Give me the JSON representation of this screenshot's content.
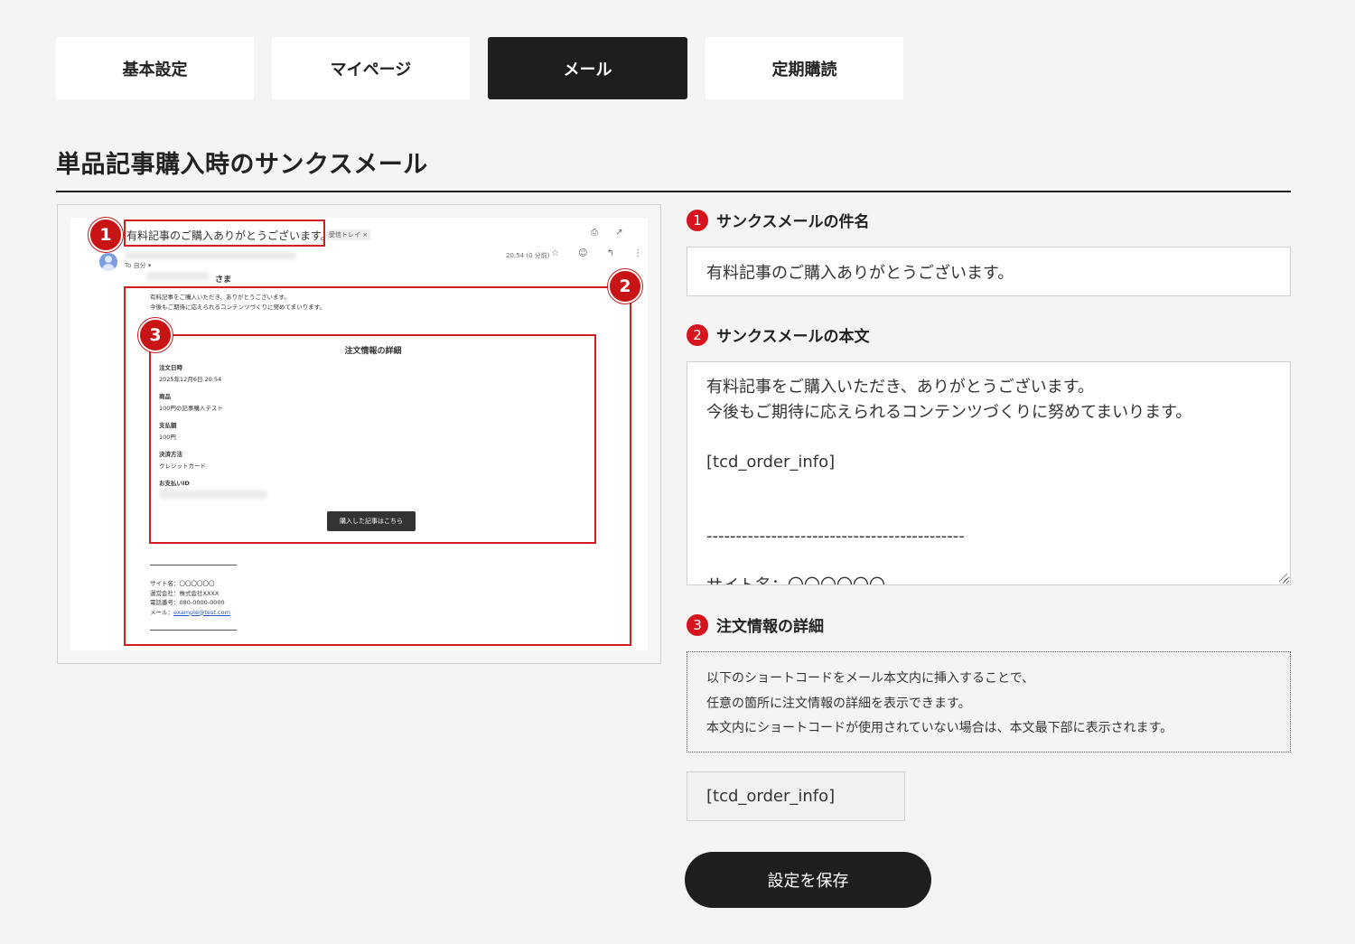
{
  "tabs": [
    {
      "label": "基本設定"
    },
    {
      "label": "マイページ"
    },
    {
      "label": "メール",
      "active": true
    },
    {
      "label": "定期購読"
    }
  ],
  "page_title": "単品記事購入時のサンクスメール",
  "preview": {
    "subject": "有料記事のご購入ありがとうございます。",
    "inbox_tag": "受信トレイ ×",
    "to_line": "To 自分 ▾",
    "time": "20:54 (0 分前)",
    "top_icons": "⎙ ↗",
    "action_icons": "☆ ☺ ↰ ⋮",
    "salutation": "さま",
    "body_lines": "有料記事をご購入いただき、ありがとうございます。\n今後もご期待に応えられるコンテンツづくりに努めてまいります。",
    "order_title": "注文情報の詳細",
    "order_fields": [
      {
        "label": "注文日時",
        "value": "2025年12月6日 20:54"
      },
      {
        "label": "商品",
        "value": "100円の記事購入テスト"
      },
      {
        "label": "支払額",
        "value": "100円"
      },
      {
        "label": "決済方法",
        "value": "クレジットカード"
      },
      {
        "label": "お支払いID",
        "value": ""
      }
    ],
    "article_button": "購入した記事はこちら",
    "footer_lines": "サイト名：〇〇〇〇〇〇\n運営会社：株式会社XXXX\n電話番号：080-0000-0000",
    "footer_mail_prefix": "メール：",
    "footer_mail": "example@test.com",
    "badges": [
      "1",
      "2",
      "3"
    ]
  },
  "fields": {
    "subject": {
      "number": "1",
      "label": "サンクスメールの件名",
      "value": "有料記事のご購入ありがとうございます。"
    },
    "body": {
      "number": "2",
      "label": "サンクスメールの本文",
      "value": "有料記事をご購入いただき、ありがとうございます。\n今後もご期待に応えられるコンテンツづくりに努めてまいります。\n\n[tcd_order_info]\n\n\n--------------------------------------------\n\nサイト名：〇〇〇〇〇〇\n運営会社：株式会社XXXX"
    },
    "order": {
      "number": "3",
      "label": "注文情報の詳細",
      "description": [
        "以下のショートコードをメール本文内に挿入することで、",
        "任意の箇所に注文情報の詳細を表示できます。",
        "本文内にショートコードが使用されていない場合は、本文最下部に表示されます。"
      ],
      "shortcode": "[tcd_order_info]"
    }
  },
  "save_button": "設定を保存",
  "colors": {
    "accent_dark": "#1e1e1e",
    "badge_red": "#d6141e",
    "highlight_red": "#d21e1e"
  }
}
